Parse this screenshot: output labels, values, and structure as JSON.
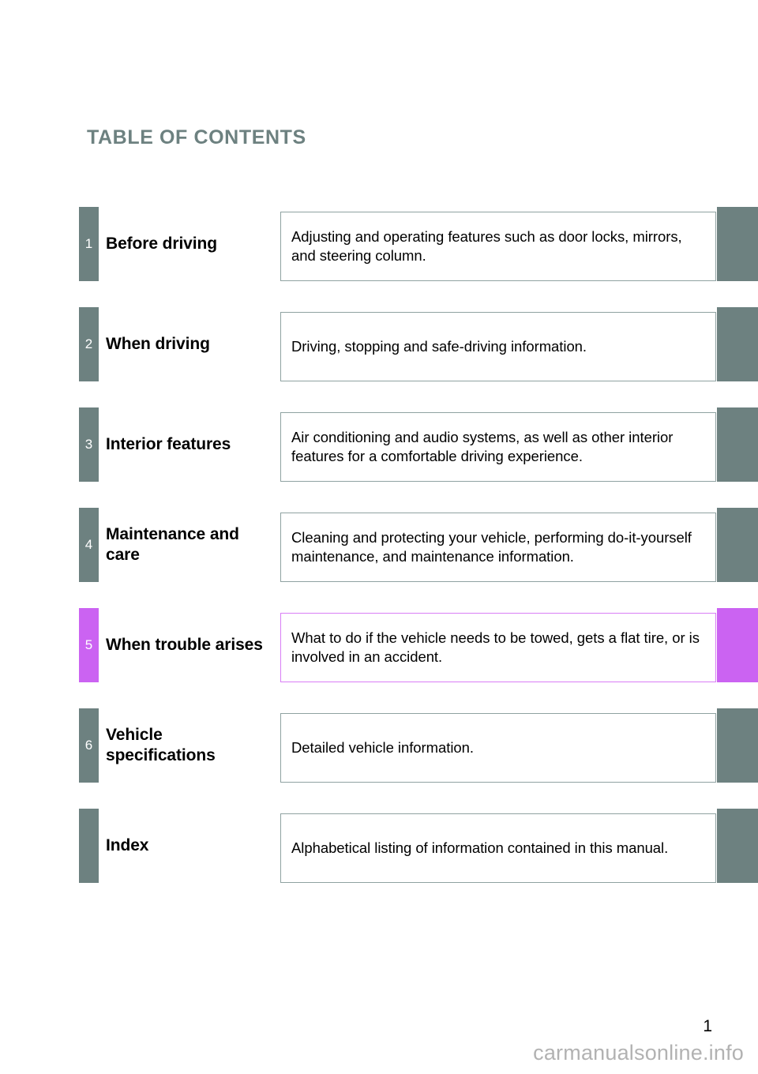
{
  "page": {
    "title": "TABLE OF CONTENTS",
    "page_number": "1",
    "watermark": "carmanualsonline.info",
    "title_color": "#6d8180",
    "tab_color": "#6d8180",
    "accent_color": "#cb63f2",
    "box_border_color": "#8fa2a1",
    "accent_border_color": "#d97ef5"
  },
  "toc": {
    "rows": [
      {
        "number": "1",
        "name": "Before driving",
        "description": "Adjusting and operating features such as door locks, mirrors, and steering column.",
        "accent": false
      },
      {
        "number": "2",
        "name": "When driving",
        "description": "Driving, stopping and safe-driving information.",
        "accent": false
      },
      {
        "number": "3",
        "name": "Interior features",
        "description": "Air conditioning and audio systems, as well as other interior features for a comfortable driving experience.",
        "accent": false
      },
      {
        "number": "4",
        "name": "Maintenance and care",
        "description": "Cleaning and protecting your vehicle, performing do-it-yourself maintenance, and maintenance information.",
        "accent": false
      },
      {
        "number": "5",
        "name": "When trouble arises",
        "description": "What to do if the vehicle needs to be towed, gets a flat tire, or is involved in an accident.",
        "accent": true
      },
      {
        "number": "6",
        "name": "Vehicle specifications",
        "description": "Detailed vehicle information.",
        "accent": false
      },
      {
        "number": "",
        "name": "Index",
        "description": "Alphabetical listing of information contained in this manual.",
        "accent": false
      }
    ]
  }
}
